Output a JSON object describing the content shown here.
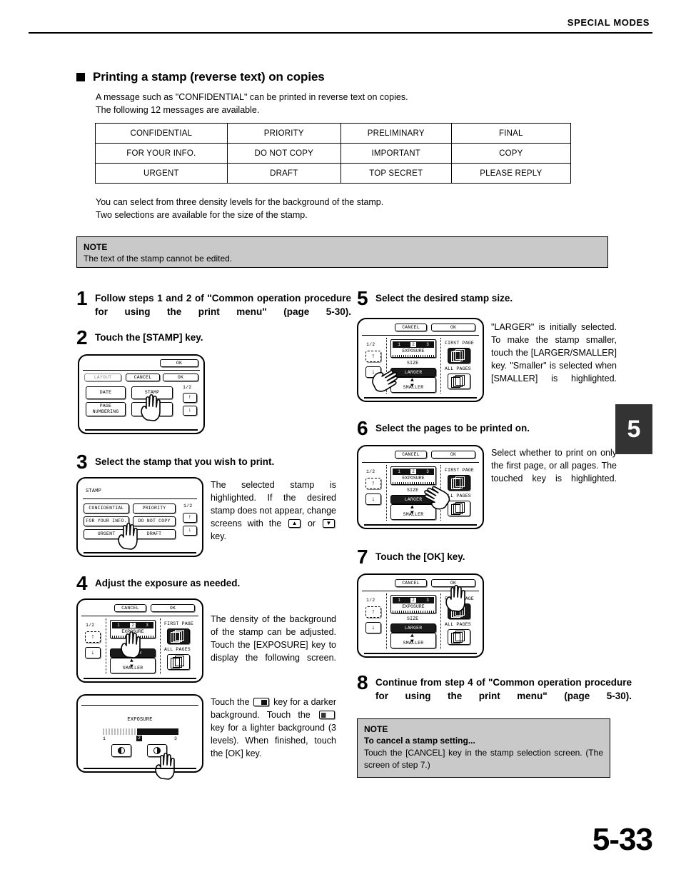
{
  "header": {
    "title": "SPECIAL MODES"
  },
  "section": {
    "bullet_icon": "square-bullet-icon",
    "title": "Printing a stamp (reverse text) on copies",
    "intro_line1": "A message such as \"CONFIDENTIAL\" can be printed in reverse text on copies.",
    "intro_line2": "The following 12 messages are available.",
    "after_table_line1": "You can select from three density levels for the background of the stamp.",
    "after_table_line2": "Two selections are available for the size of the stamp."
  },
  "stamp_table": {
    "rows": [
      [
        "CONFIDENTIAL",
        "PRIORITY",
        "PRELIMINARY",
        "FINAL"
      ],
      [
        "FOR YOUR INFO.",
        "DO NOT COPY",
        "IMPORTANT",
        "COPY"
      ],
      [
        "URGENT",
        "DRAFT",
        "TOP SECRET",
        "PLEASE REPLY"
      ]
    ]
  },
  "note_top": {
    "label": "NOTE",
    "text": "The text of the stamp cannot be edited."
  },
  "note_bottom": {
    "label": "NOTE",
    "subtitle": "To cancel a stamp setting...",
    "text": "Touch the [CANCEL] key in the stamp selection screen. (The screen of step 7.)"
  },
  "steps": {
    "s1": {
      "num": "1",
      "title": "Follow steps 1 and 2 of \"Common operation procedure for using the print menu\" (page 5-30)."
    },
    "s2": {
      "num": "2",
      "title": "Touch the [STAMP] key.",
      "panel": {
        "ok_top": "OK",
        "layout": "LAYOUT",
        "cancel": "CANCEL",
        "ok": "OK",
        "date": "DATE",
        "stamp": "STAMP",
        "page_numbering": "PAGE NUMBERING",
        "page_indicator": "1/2",
        "up_arrow": "↑",
        "down_arrow": "↓"
      }
    },
    "s3": {
      "num": "3",
      "title": "Select the stamp that you wish to print.",
      "body_a": "The selected stamp is highlighted. If the desired stamp does not appear, change screens with the",
      "body_b": "or",
      "body_c": "key.",
      "panel": {
        "heading": "STAMP",
        "page_indicator": "1/2",
        "keys": [
          "CONFIDENTIAL",
          "PRIORITY",
          "FOR YOUR INFO.",
          "DO NOT COPY",
          "URGENT",
          "DRAFT"
        ],
        "up_arrow": "↑",
        "down_arrow": "↓"
      }
    },
    "s4": {
      "num": "4",
      "title": "Adjust the exposure as needed.",
      "body": "The density of the background of the stamp can be adjusted. Touch the [EXPOSURE] key to display the following screen.",
      "body2_a": "Touch the",
      "body2_b": "key for a darker background. Touch the",
      "body2_c": "key for a lighter background (3 levels).",
      "body2_d": "When finished, touch the [OK] key.",
      "panel": {
        "cancel": "CANCEL",
        "ok": "OK",
        "page_indicator": "1/2",
        "exposure": "EXPOSURE",
        "levels": [
          "1",
          "2",
          "3"
        ],
        "size": "SIZE",
        "larger": "LARGER",
        "smaller": "SMALLER",
        "first_page": "FIRST PAGE",
        "all_pages": "ALL PAGES",
        "up_arrow": "↑",
        "down_arrow": "↓"
      },
      "expo_panel": {
        "title": "EXPOSURE",
        "min": "1",
        "current": "2",
        "max": "3"
      }
    },
    "s5": {
      "num": "5",
      "title": "Select the desired stamp size.",
      "body": "\"LARGER\" is initially selected. To make the stamp smaller, touch the [LARGER/SMALLER] key. \"Smaller\" is selected when [SMALLER] is highlighted.",
      "panel": {
        "cancel": "CANCEL",
        "ok": "OK",
        "page_indicator": "1/2",
        "exposure": "EXPOSURE",
        "levels": [
          "1",
          "2",
          "3"
        ],
        "size": "SIZE",
        "larger": "LARGER",
        "smaller": "SMALLER",
        "first_page": "FIRST PAGE",
        "all_pages": "ALL PAGES",
        "up_arrow": "↑",
        "down_arrow": "↓"
      }
    },
    "s6": {
      "num": "6",
      "title": "Select the pages to be printed on.",
      "body": "Select whether to print on only the first page, or all pages. The touched key is highlighted.",
      "panel": {
        "cancel": "CANCEL",
        "ok": "OK",
        "page_indicator": "1/2",
        "exposure": "EXPOSURE",
        "levels": [
          "1",
          "2",
          "3"
        ],
        "size": "SIZE",
        "larger": "LARGER",
        "smaller": "SMALLER",
        "first_page": "FIRST PAGE",
        "all_pages": "ALL PAGES",
        "up_arrow": "↑",
        "down_arrow": "↓"
      }
    },
    "s7": {
      "num": "7",
      "title": "Touch the [OK] key.",
      "panel": {
        "cancel": "CANCEL",
        "ok": "OK",
        "page_indicator": "1/2",
        "exposure": "EXPOSURE",
        "levels": [
          "1",
          "2",
          "3"
        ],
        "size": "SIZE",
        "larger": "LARGER",
        "smaller": "SMALLER",
        "first_page": "FIRST PAGE",
        "all_pages": "ALL PAGES",
        "up_arrow": "↑",
        "down_arrow": "↓"
      }
    },
    "s8": {
      "num": "8",
      "title": "Continue from step 4 of \"Common operation procedure for using the print menu\" (page 5-30)."
    }
  },
  "chapter_tab": "5",
  "page_number": "5-33"
}
